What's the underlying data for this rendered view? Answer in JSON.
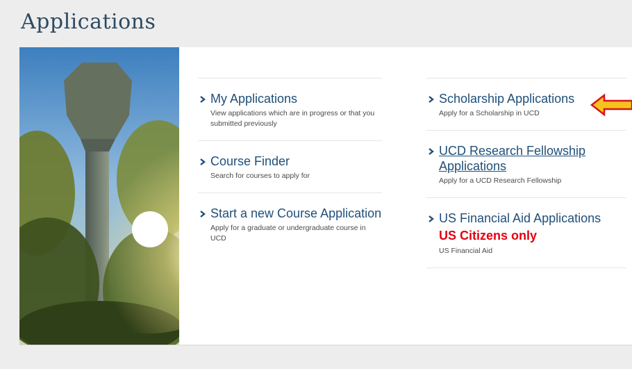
{
  "header": {
    "title": "Applications"
  },
  "left_column": [
    {
      "title": "My Applications",
      "description": "View applications which are in progress or that you submitted previously"
    },
    {
      "title": "Course Finder",
      "description": "Search for courses to apply for"
    },
    {
      "title": "Start a new Course Application",
      "description": "Apply for a graduate or undergraduate course in UCD"
    }
  ],
  "right_column": [
    {
      "title": "Scholarship Applications",
      "description": "Apply for a Scholarship in UCD"
    },
    {
      "title": "UCD Research Fellowship Applications",
      "description": "Apply for a UCD Research Fellowship"
    },
    {
      "title": "US Financial Aid Applications",
      "note": "US Citizens only",
      "description": "US Financial Aid"
    }
  ],
  "icons": {
    "chevron": "chevron-right-icon",
    "annotation": "arrow-left-icon"
  },
  "colors": {
    "link": "#1f4f79",
    "title": "#2e4a62",
    "note": "#e3000f",
    "annotation_fill": "#f7c21b",
    "annotation_stroke": "#d4141c",
    "background": "#ededed"
  }
}
